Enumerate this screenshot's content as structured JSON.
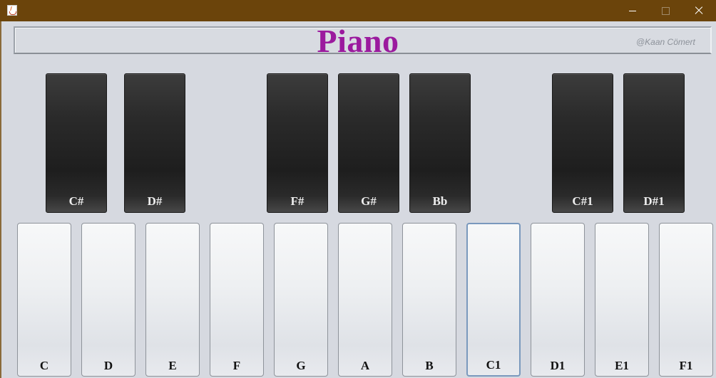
{
  "window": {
    "icon": "java-cup-icon",
    "controls": [
      "minimize-icon",
      "maximize-icon",
      "close-icon"
    ],
    "title_bar_color": "#6b440b"
  },
  "header": {
    "title": "Piano",
    "credit": "@Kaan Cömert",
    "title_color": "#9b1a9e"
  },
  "black_keys": [
    "C#",
    "D#",
    "F#",
    "G#",
    "Bb",
    "C#1",
    "D#1"
  ],
  "white_keys": [
    "C",
    "D",
    "E",
    "F",
    "G",
    "A",
    "B",
    "C1",
    "D1",
    "E1",
    "F1"
  ],
  "focused_key": "C1"
}
